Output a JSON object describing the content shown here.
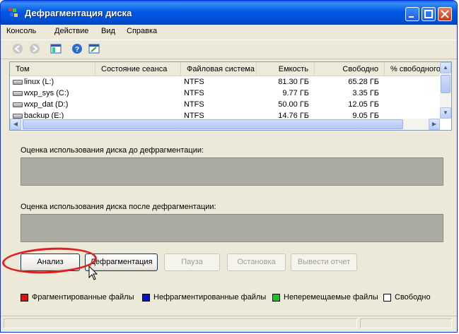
{
  "window": {
    "title": "Дефрагментация диска"
  },
  "menu": [
    "Консоль",
    "Действие",
    "Вид",
    "Справка"
  ],
  "columns": [
    "Том",
    "Состояние сеанса",
    "Файловая система",
    "Емкость",
    "Свободно",
    "% свободного"
  ],
  "volumes": [
    {
      "name": "linux (L:)",
      "status": "",
      "fs": "NTFS",
      "capacity": "81.30 ГБ",
      "free": "65.28 ГБ"
    },
    {
      "name": "wxp_sys (C:)",
      "status": "",
      "fs": "NTFS",
      "capacity": "9.77 ГБ",
      "free": "3.35 ГБ"
    },
    {
      "name": "wxp_dat (D:)",
      "status": "",
      "fs": "NTFS",
      "capacity": "50.00 ГБ",
      "free": "12.05 ГБ"
    },
    {
      "name": "backup (E:)",
      "status": "",
      "fs": "NTFS",
      "capacity": "14.76 ГБ",
      "free": "9.05 ГБ"
    }
  ],
  "analysis": {
    "before_label": "Оценка использования диска до дефрагментации:",
    "after_label": "Оценка использования диска после дефрагментации:"
  },
  "buttons": {
    "analyze": "Анализ",
    "defrag": "Дефрагментация",
    "pause": "Пауза",
    "stop": "Остановка",
    "report": "Вывести отчет"
  },
  "legend": [
    {
      "label": "Фрагментированные файлы",
      "color": "#e01010"
    },
    {
      "label": "Нефрагментированные файлы",
      "color": "#0a10c8"
    },
    {
      "label": "Неперемещаемые файлы",
      "color": "#20c020"
    },
    {
      "label": "Свободно",
      "color": "#ffffff"
    }
  ]
}
